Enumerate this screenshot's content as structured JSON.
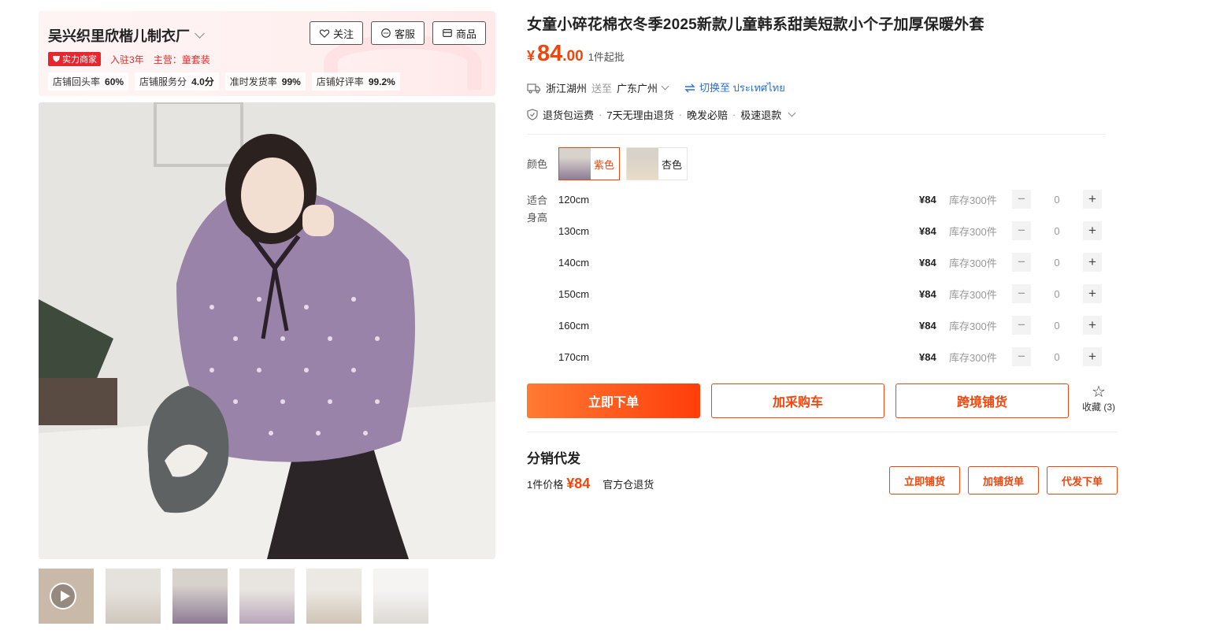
{
  "shop": {
    "name": "吴兴织里欣楷儿制衣厂",
    "buttons": {
      "follow": "关注",
      "service": "客服",
      "goods": "商品"
    },
    "badge": "实力商家",
    "years": "入驻3年",
    "main_business": "主营：童套装",
    "stats": [
      {
        "label": "店铺回头率",
        "value": "60%"
      },
      {
        "label": "店铺服务分",
        "value": "4.0分"
      },
      {
        "label": "准时发货率",
        "value": "99%"
      },
      {
        "label": "店铺好评率",
        "value": "99.2%"
      }
    ]
  },
  "product": {
    "title": "女童小碎花棉衣冬季2025新款儿童韩系甜美短款小个子加厚保暖外套",
    "price": {
      "currency": "¥",
      "integer": "84",
      "decimal": ".00",
      "moq": "1件起批"
    },
    "shipping": {
      "from": "浙江湖州",
      "to_label": "送至",
      "to": "广东广州",
      "switch": "切换至 ประเทศไทย"
    },
    "services": [
      "退货包运费",
      "7天无理由退货",
      "晚发必赔",
      "极速退款"
    ],
    "color_label": "颜色",
    "colors": [
      {
        "name": "紫色",
        "active": true
      },
      {
        "name": "杏色",
        "active": false
      }
    ],
    "size_label": "适合身高",
    "sizes": [
      {
        "size": "120cm",
        "price": "¥84",
        "stock": "库存300件",
        "qty": "0"
      },
      {
        "size": "130cm",
        "price": "¥84",
        "stock": "库存300件",
        "qty": "0"
      },
      {
        "size": "140cm",
        "price": "¥84",
        "stock": "库存300件",
        "qty": "0"
      },
      {
        "size": "150cm",
        "price": "¥84",
        "stock": "库存300件",
        "qty": "0"
      },
      {
        "size": "160cm",
        "price": "¥84",
        "stock": "库存300件",
        "qty": "0"
      },
      {
        "size": "170cm",
        "price": "¥84",
        "stock": "库存300件",
        "qty": "0"
      }
    ],
    "actions": {
      "buy": "立即下单",
      "cart": "加采购车",
      "cross": "跨境铺货"
    },
    "favorite": {
      "label": "收藏",
      "count": "(3)"
    }
  },
  "distribution": {
    "title": "分销代发",
    "price_label": "1件价格",
    "price": "¥84",
    "note": "官方仓退货",
    "buttons": {
      "now": "立即铺货",
      "list": "加铺货单",
      "order": "代发下单"
    }
  },
  "colors": {
    "accent": "#f2450c",
    "badge": "#e7262f",
    "link": "#2a6ed8"
  }
}
